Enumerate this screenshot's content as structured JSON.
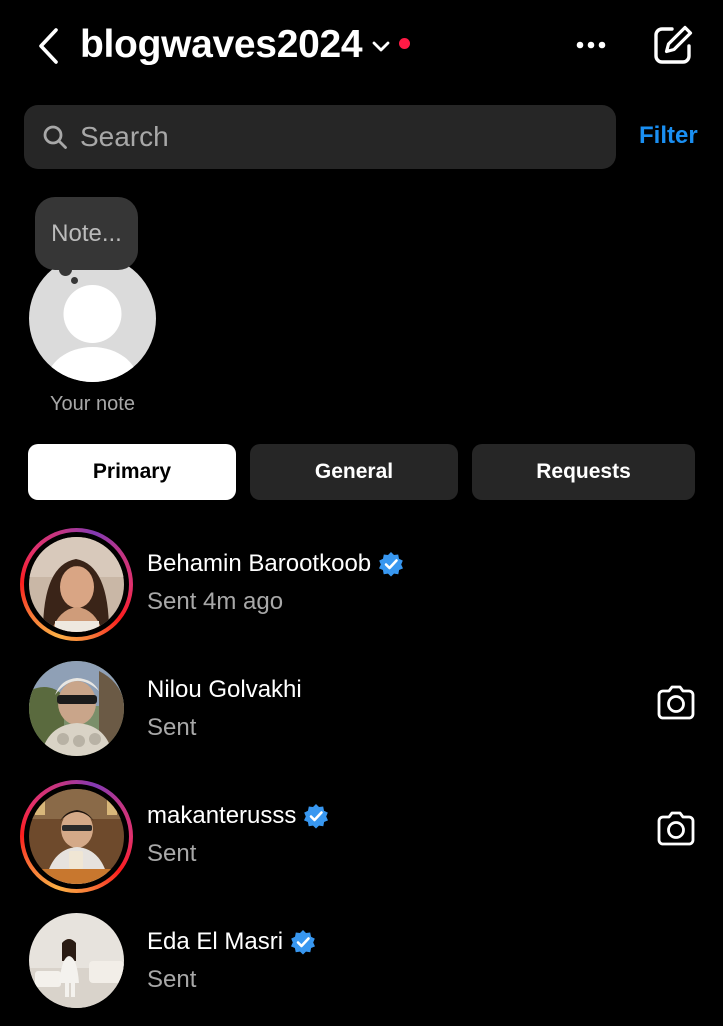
{
  "header": {
    "account_name": "blogwaves2024",
    "has_unread": true,
    "icons": {
      "back": "chevron-left-icon",
      "switch": "chevron-down-icon",
      "more": "more-horizontal-icon",
      "compose": "compose-icon"
    }
  },
  "search": {
    "placeholder": "Search",
    "value": "",
    "filter_label": "Filter"
  },
  "note": {
    "bubble_placeholder": "Note...",
    "label": "Your note"
  },
  "tabs": [
    {
      "label": "Primary",
      "active": true
    },
    {
      "label": "General",
      "active": false
    },
    {
      "label": "Requests",
      "active": false
    }
  ],
  "threads": [
    {
      "name": "Behamin Barootkoob",
      "verified": true,
      "status": "Sent 4m ago",
      "has_story": true,
      "camera": false
    },
    {
      "name": "Nilou Golvakhi",
      "verified": false,
      "status": "Sent",
      "has_story": false,
      "camera": true
    },
    {
      "name": "makanterusss",
      "verified": true,
      "status": "Sent",
      "has_story": true,
      "camera": true
    },
    {
      "name": "Eda El Masri",
      "verified": true,
      "status": "Sent",
      "has_story": false,
      "camera": false
    }
  ],
  "colors": {
    "background": "#000000",
    "accent": "#1A8FF2",
    "verified": "#3897F0",
    "unread_dot": "#FF1A45",
    "secondary_text": "#A8A8A8",
    "surface": "#262626"
  }
}
